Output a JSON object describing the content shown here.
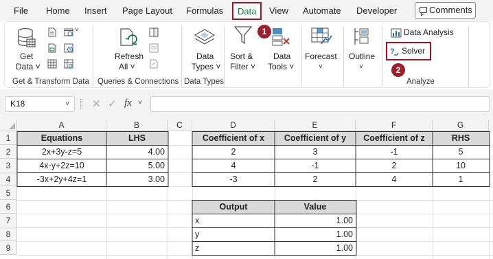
{
  "menu": {
    "items": [
      "File",
      "Home",
      "Insert",
      "Page Layout",
      "Formulas",
      "Data",
      "View",
      "Automate",
      "Developer"
    ],
    "active": "Data",
    "comments_label": "Comments"
  },
  "ribbon": {
    "get_data_top": "Get",
    "get_data_bottom": "Data ˅",
    "group_get_transform": "Get & Transform Data",
    "refresh_top": "Refresh",
    "refresh_bottom": "All ˅",
    "group_queries": "Queries & Connections",
    "data_types_top": "Data",
    "data_types_bottom": "Types ˅",
    "group_data_types": "Data Types",
    "sort_filter_top": "Sort &",
    "sort_filter_bottom": "Filter ˅",
    "data_tools_top": "Data",
    "data_tools_bottom": "Tools ˅",
    "forecast_label": "Forecast",
    "forecast_dd": "˅",
    "outline_label": "Outline",
    "outline_dd": "˅",
    "data_analysis_label": "Data Analysis",
    "solver_label": "Solver",
    "group_analyze": "Analyze",
    "callout_1": "1",
    "callout_2": "2"
  },
  "formula_bar": {
    "name_box": "K18",
    "name_box_dd": "˅",
    "cancel_glyph": "✕",
    "enter_glyph": "✓",
    "fx_label": "fx",
    "formula": ""
  },
  "sheet": {
    "columns": [
      "A",
      "B",
      "C",
      "D",
      "E",
      "F",
      "G"
    ],
    "rows": [
      "1",
      "2",
      "3",
      "4",
      "5",
      "6",
      "7",
      "8",
      "9"
    ],
    "equations_table": {
      "headers": [
        "Equations",
        "LHS"
      ],
      "rows": [
        [
          "2x+3y-z=5",
          "4.00"
        ],
        [
          "4x-y+2z=10",
          "5.00"
        ],
        [
          "-3x+2y+4z=1",
          "3.00"
        ]
      ]
    },
    "coeff_table": {
      "headers": [
        "Coefficient of x",
        "Coefficient of y",
        "Coefficient of z",
        "RHS"
      ],
      "rows": [
        [
          "2",
          "3",
          "-1",
          "5"
        ],
        [
          "4",
          "-1",
          "2",
          "10"
        ],
        [
          "-3",
          "2",
          "4",
          "1"
        ]
      ]
    },
    "output_table": {
      "headers": [
        "Output",
        "Value"
      ],
      "rows": [
        [
          "x",
          "1.00"
        ],
        [
          "y",
          "1.00"
        ],
        [
          "z",
          "1.00"
        ]
      ]
    }
  },
  "colors": {
    "accent_green": "#107c41",
    "callout_red": "#9c1f2c",
    "header_fill": "#d9d9d9"
  }
}
